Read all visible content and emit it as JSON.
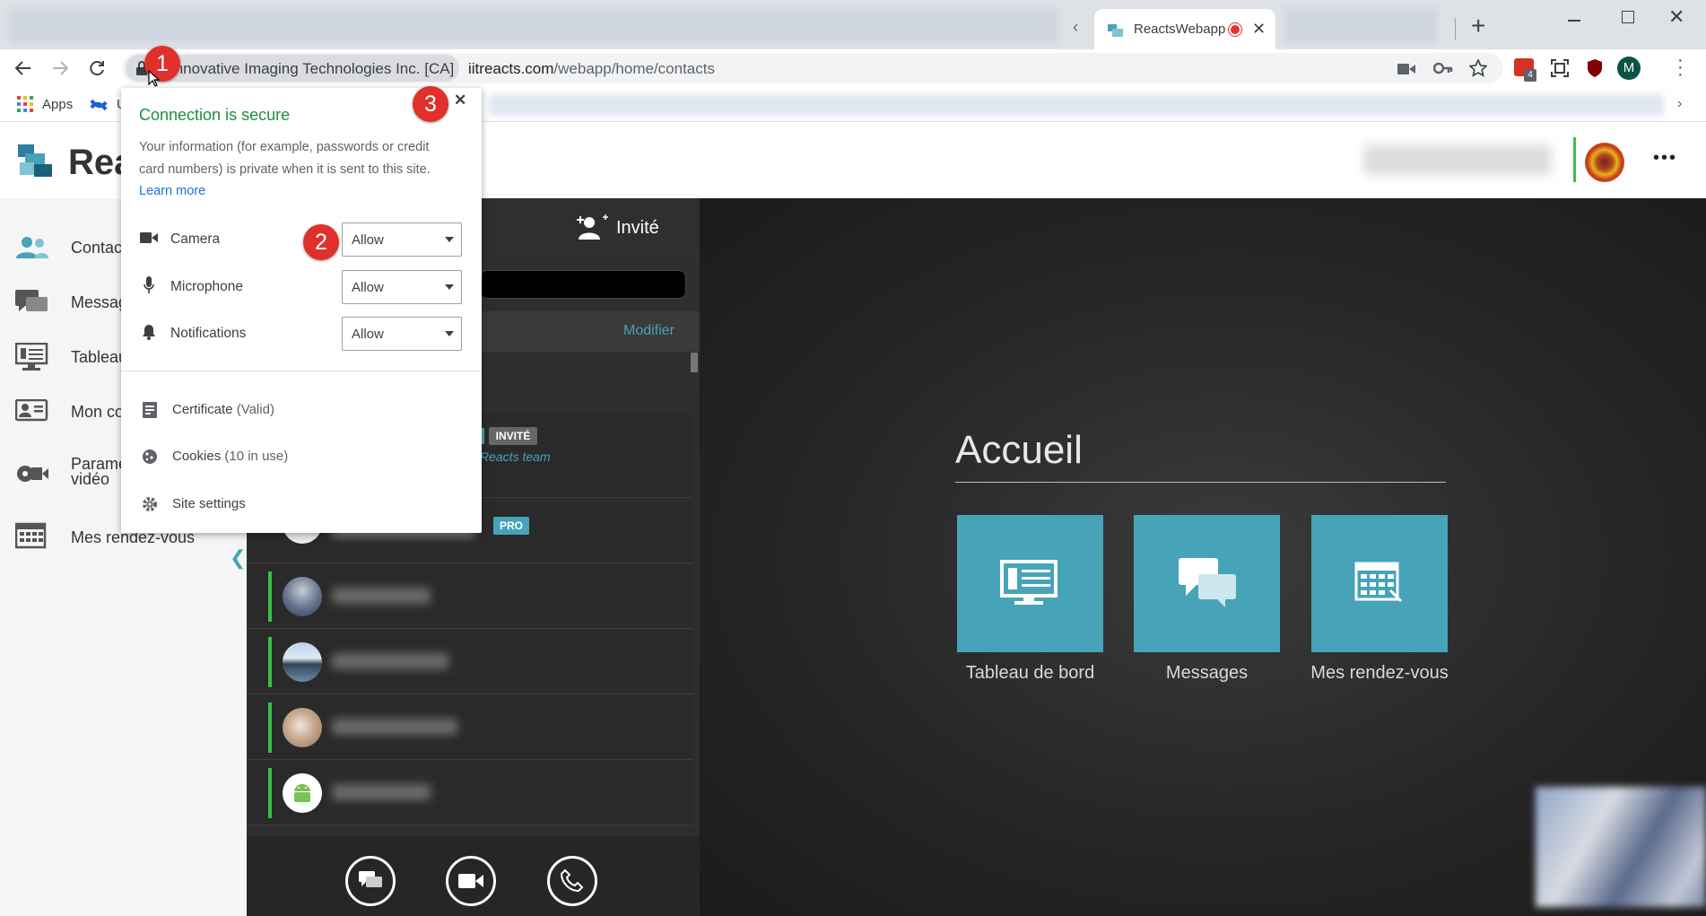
{
  "browser": {
    "active_tab_title": "ReactsWebapp",
    "new_tab_symbol": "+",
    "origin": "Innovative Imaging Technologies Inc. [CA]",
    "url_host": "iitreacts.com",
    "url_path": "/webapp/home/contacts",
    "profile_initial": "M",
    "extension_badge": "4",
    "bookmarks": {
      "apps_label": "Apps",
      "partial_label": "U"
    }
  },
  "app": {
    "logo_text": "Rea",
    "menu_dots": "•••"
  },
  "sidebar": {
    "items": [
      {
        "label": "Contac"
      },
      {
        "label": "Messag"
      },
      {
        "label": "Tableau"
      },
      {
        "label": "Mon co"
      },
      {
        "label": "Paramè",
        "label2": "vidéo"
      },
      {
        "label": "Mes rendez-vous"
      }
    ],
    "collapse_symbol": "❮"
  },
  "contacts": {
    "invite_label": "Invité",
    "modify_label": "Modifier",
    "invite_badge": "INVITÉ",
    "team_text": "Reacts team",
    "pro_badge": "PRO"
  },
  "home": {
    "title": "Accueil",
    "tiles": [
      {
        "label": "Tableau de bord",
        "icon": "dashboard-icon"
      },
      {
        "label": "Messages",
        "icon": "chat-icon"
      },
      {
        "label": "Mes rendez-vous",
        "icon": "calendar-icon"
      }
    ]
  },
  "popup": {
    "title": "Connection is secure",
    "body": "Your information (for example, passwords or credit card numbers) is private when it is sent to this site.",
    "learn_more": "Learn more",
    "close": "✕",
    "permissions": [
      {
        "label": "Camera",
        "value": "Allow",
        "icon": "camera-icon"
      },
      {
        "label": "Microphone",
        "value": "Allow",
        "icon": "microphone-icon"
      },
      {
        "label": "Notifications",
        "value": "Allow",
        "icon": "bell-icon"
      }
    ],
    "certificate": "Certificate",
    "certificate_status": "(Valid)",
    "cookies": "Cookies",
    "cookies_status": "(10 in use)",
    "site_settings": "Site settings"
  },
  "annotations": [
    "1",
    "2",
    "3"
  ],
  "colors": {
    "accent_green": "#1e8e3e",
    "tile_teal": "#47a3b8",
    "badge_red": "#e0302b",
    "status_green": "#3bbf4a"
  }
}
